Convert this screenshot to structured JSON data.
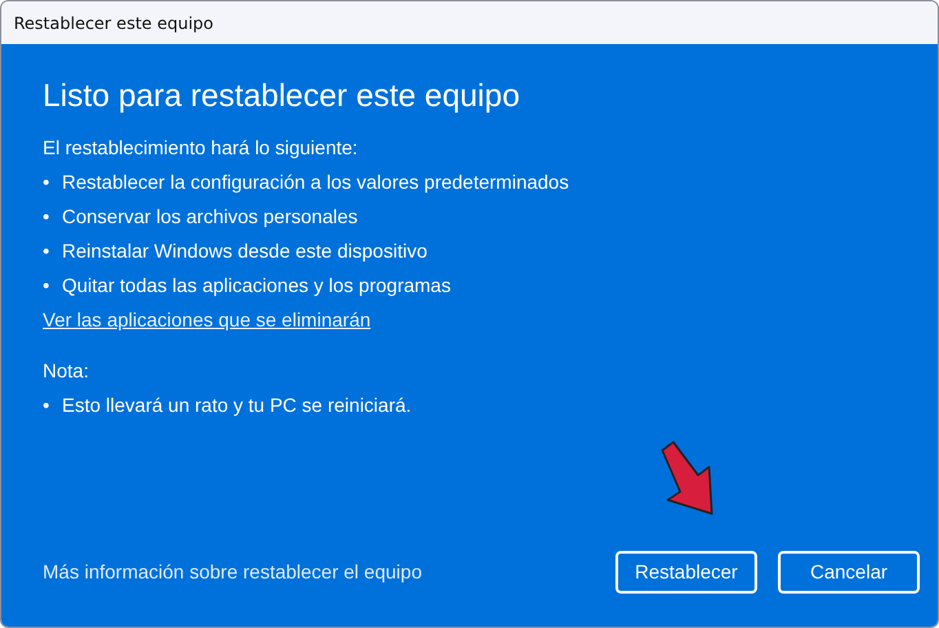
{
  "window": {
    "title": "Restablecer este equipo"
  },
  "heading": "Listo para restablecer este equipo",
  "intro": "El restablecimiento hará lo siguiente:",
  "items": [
    {
      "bullet": "•",
      "text": "Restablecer la configuración a los valores predeterminados"
    },
    {
      "bullet": "•",
      "text": "Conservar los archivos personales"
    },
    {
      "bullet": "•",
      "text": "Reinstalar Windows desde este dispositivo"
    },
    {
      "bullet": "•",
      "text": "Quitar todas las aplicaciones y los programas"
    }
  ],
  "link": "Ver las aplicaciones que se eliminarán",
  "note_label": "Nota:",
  "note_items": [
    {
      "bullet": "•",
      "text": "Esto llevará un rato y tu PC se reiniciará."
    }
  ],
  "footer_link": "Más información sobre restablecer el equipo",
  "buttons": [
    {
      "label": "Restablecer"
    },
    {
      "label": "Cancelar"
    }
  ]
}
